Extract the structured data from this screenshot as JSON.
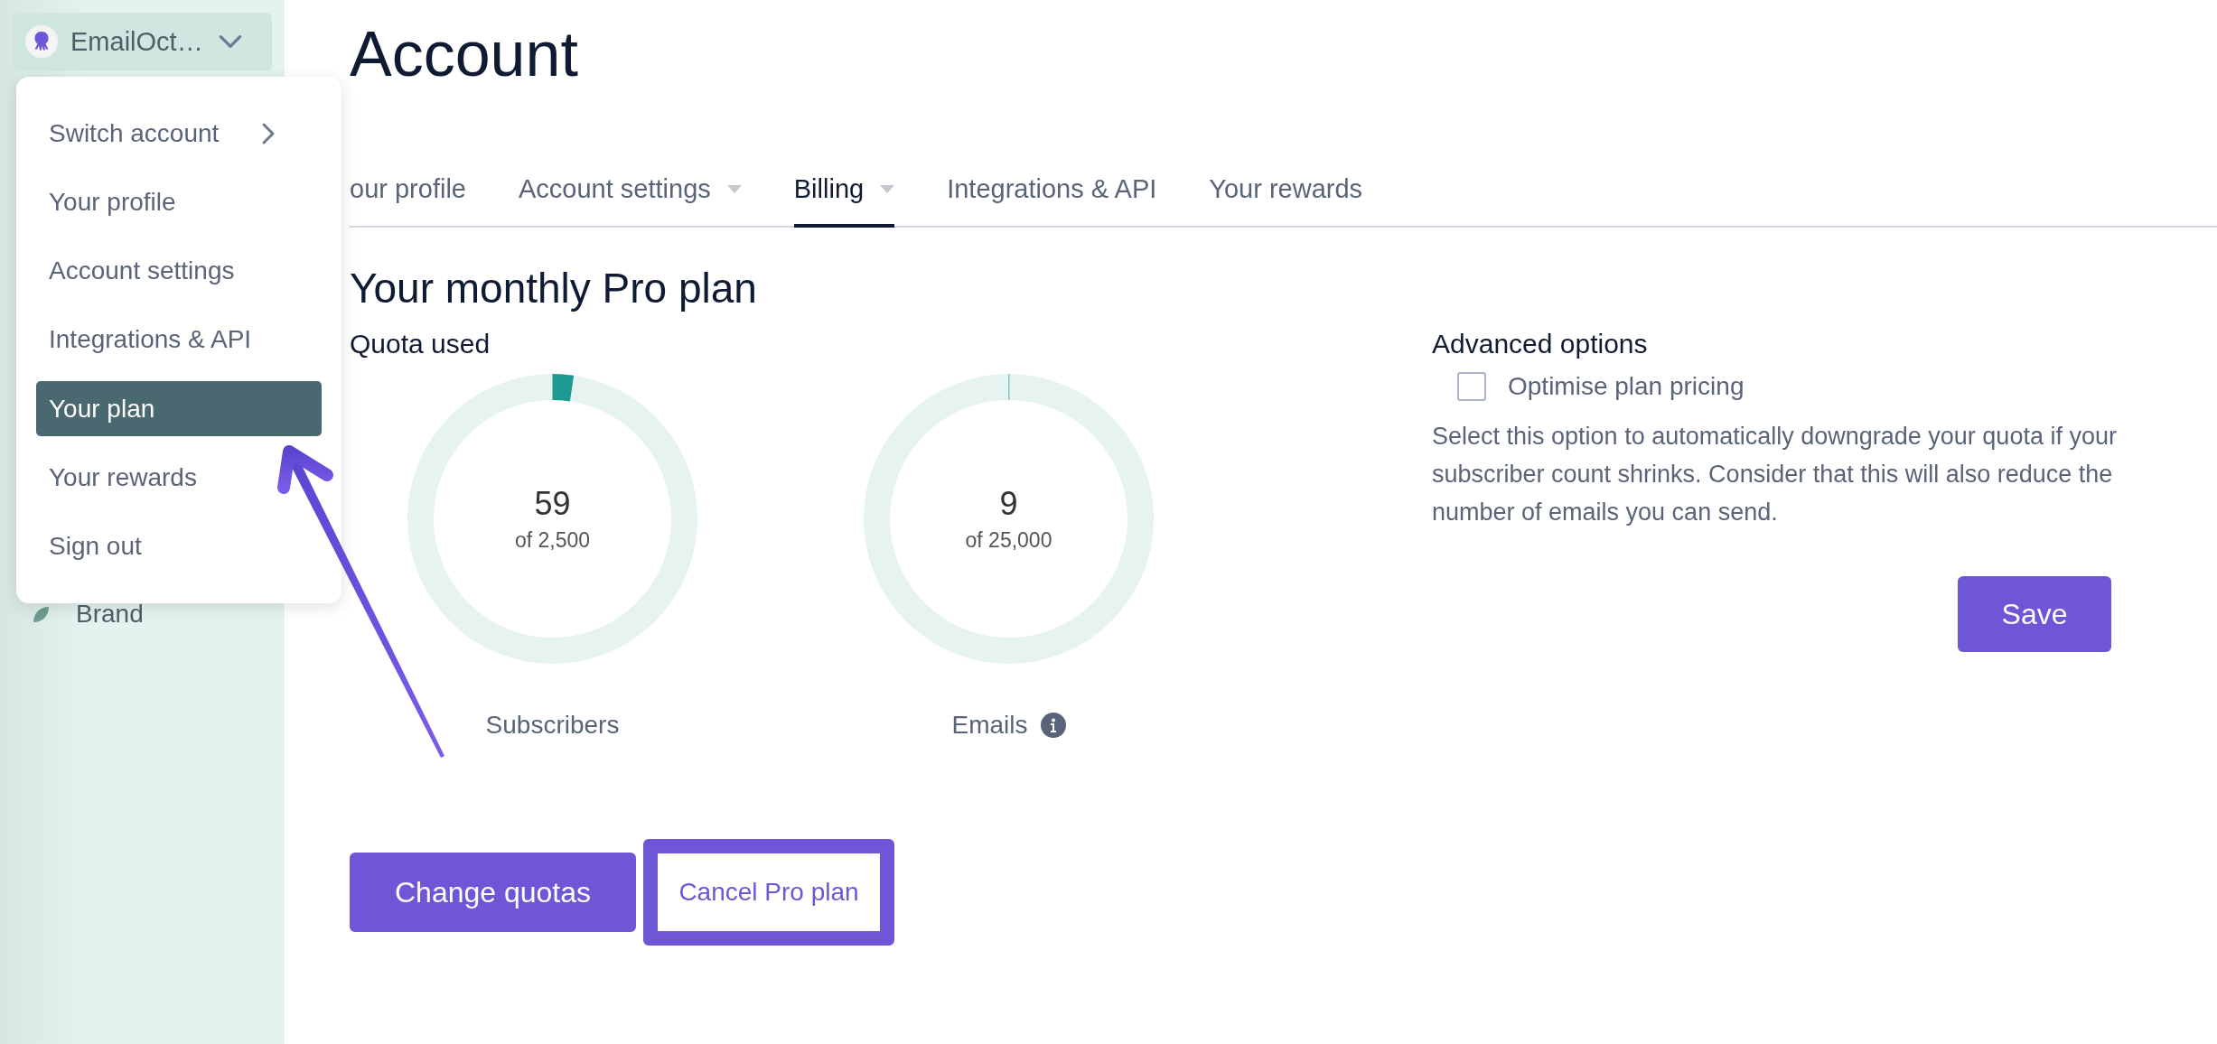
{
  "account_switcher": {
    "name": "EmailOct…"
  },
  "account_menu": [
    {
      "label": "Switch account",
      "submenu": true,
      "selected": false
    },
    {
      "label": "Your profile",
      "submenu": false,
      "selected": false
    },
    {
      "label": "Account settings",
      "submenu": false,
      "selected": false
    },
    {
      "label": "Integrations & API",
      "submenu": false,
      "selected": false
    },
    {
      "label": "Your plan",
      "submenu": false,
      "selected": true
    },
    {
      "label": "Your rewards",
      "submenu": false,
      "selected": false
    },
    {
      "label": "Sign out",
      "submenu": false,
      "selected": false
    }
  ],
  "sidebar": {
    "items": [
      {
        "label": "Brand"
      }
    ]
  },
  "page": {
    "title": "Account"
  },
  "tabs": [
    {
      "label": "our profile",
      "selected": false,
      "dropdown": false
    },
    {
      "label": "Account settings",
      "selected": false,
      "dropdown": true
    },
    {
      "label": "Billing",
      "selected": true,
      "dropdown": true
    },
    {
      "label": "Integrations & API",
      "selected": false,
      "dropdown": false
    },
    {
      "label": "Your rewards",
      "selected": false,
      "dropdown": false
    }
  ],
  "plan": {
    "title": "Your monthly Pro plan",
    "quota": {
      "title": "Quota used",
      "meters": [
        {
          "value": "59",
          "of": "of 2,500",
          "label": "Subscribers",
          "level": 0.0236,
          "info": false
        },
        {
          "value": "9",
          "of": "of 25,000",
          "label": "Emails",
          "level": 0.0004,
          "info": true
        }
      ]
    },
    "advanced": {
      "title": "Advanced options",
      "option": {
        "label": "Optimise plan pricing",
        "checked": false
      },
      "description": "Select this option to automatically downgrade your quota if your subscriber count shrinks. Consider that this will also reduce the number of emails you can send.",
      "save": "Save"
    },
    "buttons": [
      {
        "label": "Change quotas",
        "kind": "primary"
      },
      {
        "label": "Cancel Pro plan",
        "kind": "outline"
      }
    ]
  }
}
